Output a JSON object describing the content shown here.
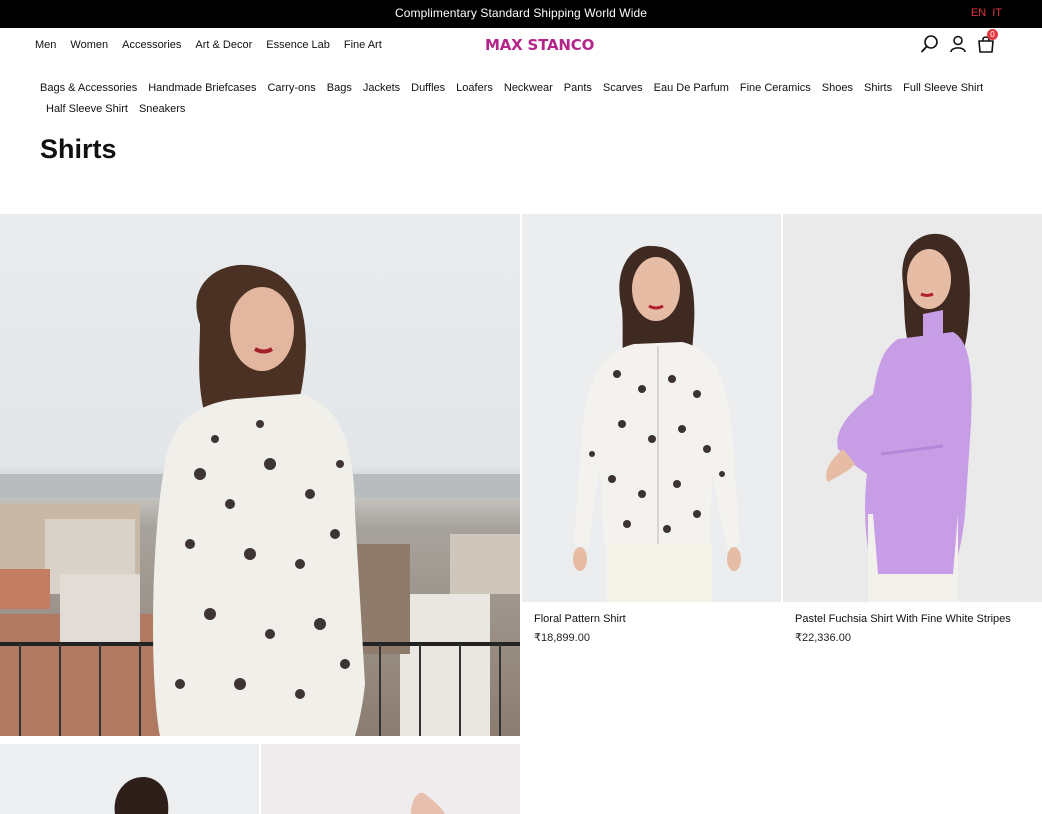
{
  "announcement": {
    "text": "Complimentary Standard Shipping World Wide",
    "lang_en": "EN",
    "lang_it": "IT"
  },
  "nav": {
    "items": [
      "Men",
      "Women",
      "Accessories",
      "Art & Decor",
      "Essence Lab",
      "Fine Art"
    ]
  },
  "logo": {
    "text": "MAX STANCO",
    "color": "#b5248a"
  },
  "header": {
    "icons": [
      "search-icon",
      "user-icon",
      "cart-icon"
    ],
    "cart_count": "0"
  },
  "categories": {
    "row1": [
      "Bags & Accessories",
      "Handmade Briefcases",
      "Carry-ons",
      "Bags",
      "Jackets",
      "Duffles",
      "Loafers",
      "Neckwear",
      "Pants",
      "Scarves",
      "Eau De Parfum",
      "Fine Ceramics",
      "Shoes",
      "Shirts",
      "Full Sleeve Shirt"
    ],
    "row2": [
      "Half Sleeve Shirt",
      "Sneakers"
    ]
  },
  "page": {
    "title": "Shirts"
  },
  "products": [
    {
      "name": "Floral Pattern Shirt",
      "price": "₹18,899.00"
    },
    {
      "name": "Pastel Fuchsia Shirt With Fine White Stripes",
      "price": "₹22,336.00"
    }
  ],
  "colors": {
    "accent": "#e4373f",
    "topbar": "#000000",
    "lilac_shirt": "#c79ee6"
  }
}
